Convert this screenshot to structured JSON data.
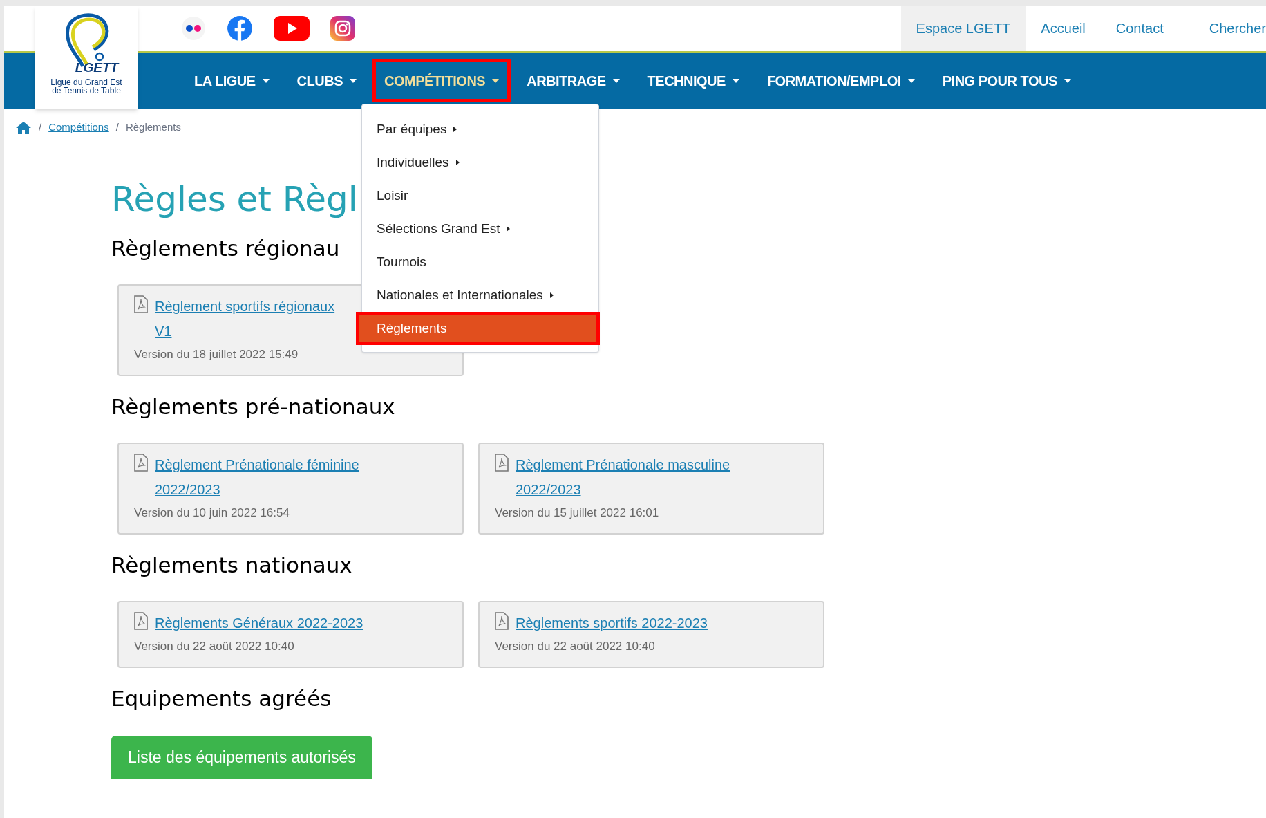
{
  "logo": {
    "mark": "LGETT",
    "caption": "Ligue du Grand Est de Tennis de Table"
  },
  "top_links": [
    {
      "label": "Espace LGETT",
      "selected": true
    },
    {
      "label": "Accueil",
      "selected": false
    },
    {
      "label": "Contact",
      "selected": false
    },
    {
      "label": "Chercher",
      "selected": false
    }
  ],
  "nav": [
    {
      "label": "LA LIGUE",
      "selected": false,
      "highlighted": false
    },
    {
      "label": "CLUBS",
      "selected": false,
      "highlighted": false
    },
    {
      "label": "COMPÉTITIONS",
      "selected": true,
      "highlighted": true
    },
    {
      "label": "ARBITRAGE",
      "selected": false,
      "highlighted": false
    },
    {
      "label": "TECHNIQUE",
      "selected": false,
      "highlighted": false
    },
    {
      "label": "FORMATION/EMPLOI",
      "selected": false,
      "highlighted": false
    },
    {
      "label": "PING POUR TOUS",
      "selected": false,
      "highlighted": false
    }
  ],
  "dropdown": [
    {
      "label": "Par équipes",
      "submenu": true,
      "selected": false,
      "highlighted": false
    },
    {
      "label": "Individuelles",
      "submenu": true,
      "selected": false,
      "highlighted": false
    },
    {
      "label": "Loisir",
      "submenu": false,
      "selected": false,
      "highlighted": false
    },
    {
      "label": "Sélections Grand Est",
      "submenu": true,
      "selected": false,
      "highlighted": false
    },
    {
      "label": "Tournois",
      "submenu": false,
      "selected": false,
      "highlighted": false
    },
    {
      "label": "Nationales et Internationales",
      "submenu": true,
      "selected": false,
      "highlighted": false
    },
    {
      "label": "Règlements",
      "submenu": false,
      "selected": true,
      "highlighted": true
    }
  ],
  "breadcrumb": [
    {
      "separator": "/",
      "label": "Compétitions"
    },
    {
      "separator": "/",
      "label": "Règlements"
    }
  ],
  "title": "Règles et Règl",
  "sections": [
    {
      "heading": "Règlements régionau",
      "documents": [
        {
          "title_lines": [
            "Règlement sportifs régionaux",
            "V1"
          ],
          "version": "Version du 18 juillet 2022 15:49"
        }
      ]
    },
    {
      "heading": "Règlements pré-nationaux",
      "documents": [
        {
          "title_lines": [
            "Règlement Prénationale féminine",
            "2022/2023"
          ],
          "version": "Version du 10 juin 2022 16:54"
        },
        {
          "title_lines": [
            "Règlement Prénationale masculine",
            "2022/2023"
          ],
          "version": "Version du 15 juillet 2022 16:01"
        }
      ]
    },
    {
      "heading": "Règlements nationaux",
      "documents": [
        {
          "title_lines": [
            "Règlements Généraux 2022-2023"
          ],
          "version": "Version du 22 août 2022 10:40"
        },
        {
          "title_lines": [
            "Règlements sportifs 2022-2023"
          ],
          "version": "Version du 22 août 2022 10:40"
        }
      ]
    },
    {
      "heading": "Equipements agréés",
      "button": "Liste des équipements autorisés"
    }
  ]
}
